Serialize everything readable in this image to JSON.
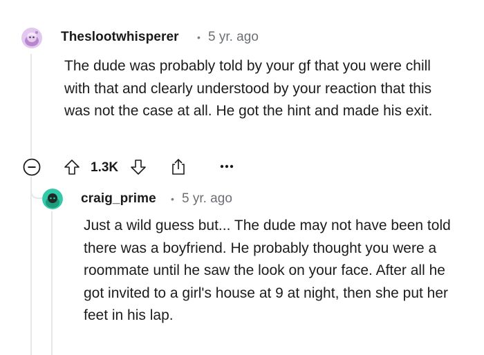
{
  "comments": [
    {
      "username": "Theslootwhisperer",
      "separator": "•",
      "time": "5 yr. ago",
      "body": "The dude was probably told by your gf that you were chill with that and clearly understood by your reaction that this was not the case at all. He got the hint and made his exit.",
      "score": "1.3K",
      "avatar_color": "#c49ad6",
      "icons": {
        "collapse": "collapse-minus-icon",
        "upvote": "upvote-arrow-icon",
        "downvote": "downvote-arrow-icon",
        "share": "share-icon",
        "more": "more-dots-icon"
      }
    },
    {
      "username": "craig_prime",
      "separator": "•",
      "time": "5 yr. ago",
      "body": "Just a wild guess but... The dude may not have been told there was a boyfriend. He probably thought you were a roommate until he saw the look on your face. After all he got invited to a girl's house at 9 at night, then she put her feet in his lap.",
      "avatar_color": "#2ec4a3"
    }
  ]
}
